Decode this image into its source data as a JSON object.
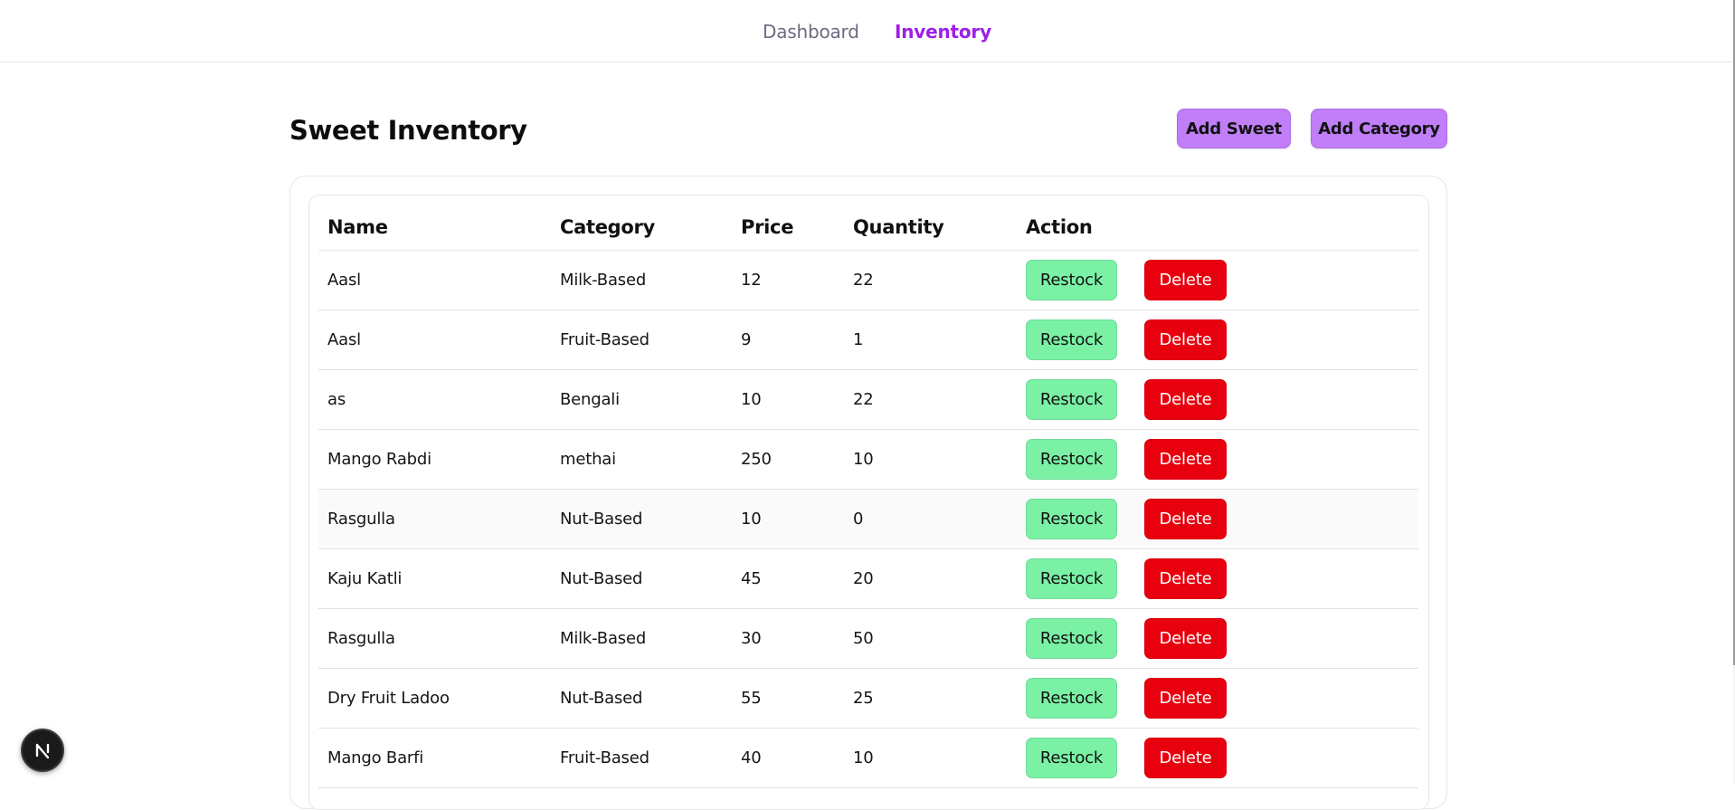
{
  "nav": {
    "items": [
      {
        "label": "Dashboard",
        "active": false
      },
      {
        "label": "Inventory",
        "active": true
      }
    ],
    "active_color": "#9d1fe6",
    "inactive_color": "#6b6b80"
  },
  "header": {
    "title": "Sweet Inventory",
    "add_sweet_label": "Add Sweet",
    "add_category_label": "Add Category",
    "button_color": "#c07ef8"
  },
  "table": {
    "columns": [
      "Name",
      "Category",
      "Price",
      "Quantity",
      "Action"
    ],
    "rows": [
      {
        "name": "Aasl",
        "category": "Milk-Based",
        "price": "12",
        "quantity": "22"
      },
      {
        "name": "Aasl",
        "category": "Fruit-Based",
        "price": "9",
        "quantity": "1"
      },
      {
        "name": "as",
        "category": "Bengali",
        "price": "10",
        "quantity": "22"
      },
      {
        "name": "Mango Rabdi",
        "category": "methai",
        "price": "250",
        "quantity": "10"
      },
      {
        "name": "Rasgulla",
        "category": "Nut-Based",
        "price": "10",
        "quantity": "0"
      },
      {
        "name": "Kaju Katli",
        "category": "Nut-Based",
        "price": "45",
        "quantity": "20"
      },
      {
        "name": "Rasgulla",
        "category": "Milk-Based",
        "price": "30",
        "quantity": "50"
      },
      {
        "name": "Dry Fruit Ladoo",
        "category": "Nut-Based",
        "price": "55",
        "quantity": "25"
      },
      {
        "name": "Mango Barfi",
        "category": "Fruit-Based",
        "price": "40",
        "quantity": "10"
      }
    ],
    "restock_label": "Restock",
    "delete_label": "Delete",
    "restock_color": "#7af1a5",
    "delete_color": "#e8000e"
  },
  "badge": {
    "icon": "nextjs-logo-icon",
    "glyph": "N"
  }
}
